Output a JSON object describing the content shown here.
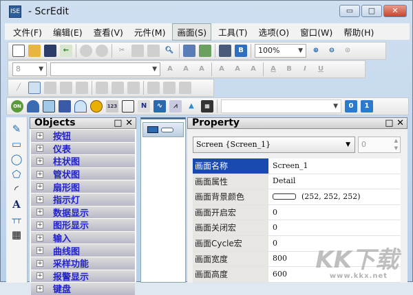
{
  "window": {
    "title": "- ScrEdit",
    "icon_label": "ISE",
    "min": "▭",
    "max": "□",
    "close": "✕"
  },
  "menu": [
    "文件(F)",
    "编辑(E)",
    "查看(V)",
    "元件(M)",
    "画面(S)",
    "工具(T)",
    "选项(O)",
    "窗口(W)",
    "帮助(H)"
  ],
  "toolbar": {
    "zoom": "100%",
    "font_size": "8",
    "font_name": ""
  },
  "objects": {
    "title": "Objects",
    "items": [
      "按钮",
      "仪表",
      "柱状图",
      "管状图",
      "扇形图",
      "指示灯",
      "数据显示",
      "图形显示",
      "输入",
      "曲线图",
      "采样功能",
      "报警显示",
      "键盘"
    ]
  },
  "property": {
    "title": "Property",
    "selector": "Screen {Screen_1}",
    "spin": "0",
    "rows": [
      {
        "label": "画面名称",
        "value": "Screen_1"
      },
      {
        "label": "画面属性",
        "value": "Detail"
      },
      {
        "label": "画面背景颜色",
        "value": "(252, 252, 252)"
      },
      {
        "label": "画面开启宏",
        "value": "0"
      },
      {
        "label": "画面关闭宏",
        "value": "0"
      },
      {
        "label": "画面Cycle宏",
        "value": "0"
      },
      {
        "label": "画面宽度",
        "value": "800"
      },
      {
        "label": "画面高度",
        "value": "600"
      }
    ]
  },
  "watermark": {
    "logo": "KK下载",
    "url": "www.kkx.net"
  }
}
